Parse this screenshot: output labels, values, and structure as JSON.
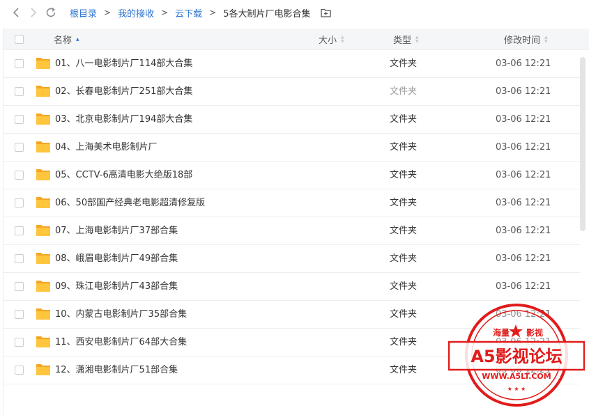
{
  "breadcrumb": {
    "items": [
      "根目录",
      "我的接收",
      "云下载"
    ],
    "separator": ">",
    "current": "5各大制片厂电影合集"
  },
  "columns": {
    "name": "名称",
    "size": "大小",
    "type": "类型",
    "modified": "修改时间",
    "sorted_by": "name",
    "sort_direction": "ascending"
  },
  "files": [
    {
      "name": "01、八一电影制片厂114部大合集",
      "type": "文件夹",
      "modified": "03-06 12:21"
    },
    {
      "name": "02、长春电影制片厂251部大合集",
      "type": "文件夹",
      "modified": "03-06 12:21"
    },
    {
      "name": "03、北京电影制片厂194部大合集",
      "type": "文件夹",
      "modified": "03-06 12:21"
    },
    {
      "name": "04、上海美术电影制片厂",
      "type": "文件夹",
      "modified": "03-06 12:21"
    },
    {
      "name": "05、CCTV-6高清电影大绝版18部",
      "type": "文件夹",
      "modified": "03-06 12:21"
    },
    {
      "name": "06、50部国产经典老电影超清修复版",
      "type": "文件夹",
      "modified": "03-06 12:21"
    },
    {
      "name": "07、上海电影制片厂37部合集",
      "type": "文件夹",
      "modified": "03-06 12:21"
    },
    {
      "name": "08、峨眉电影制片厂49部合集",
      "type": "文件夹",
      "modified": "03-06 12:21"
    },
    {
      "name": "09、珠江电影制片厂43部合集",
      "type": "文件夹",
      "modified": "03-06 12:21"
    },
    {
      "name": "10、内蒙古电影制片厂35部合集",
      "type": "文件夹",
      "modified": "03-06 12:21"
    },
    {
      "name": "11、西安电影制片厂64部大合集",
      "type": "文件夹",
      "modified": "03-06 12:21"
    },
    {
      "name": "12、潇湘电影制片厂51部合集",
      "type": "文件夹",
      "modified": "03-06 12:21"
    }
  ],
  "watermark": {
    "top_left": "海量",
    "top_right": "影视",
    "main": "A5影视论坛",
    "url": "WWW.A5LT.COM"
  },
  "colors": {
    "link": "#2b73d1",
    "folder": "#ffc53d",
    "folder_dark": "#f5a623",
    "header_bg": "#f5f6f8",
    "watermark_red": "#e11b1b"
  },
  "icons": [
    "back-arrow-icon",
    "forward-arrow-icon",
    "refresh-icon",
    "new-folder-icon",
    "folder-icon",
    "sort-icon",
    "star-icon"
  ]
}
